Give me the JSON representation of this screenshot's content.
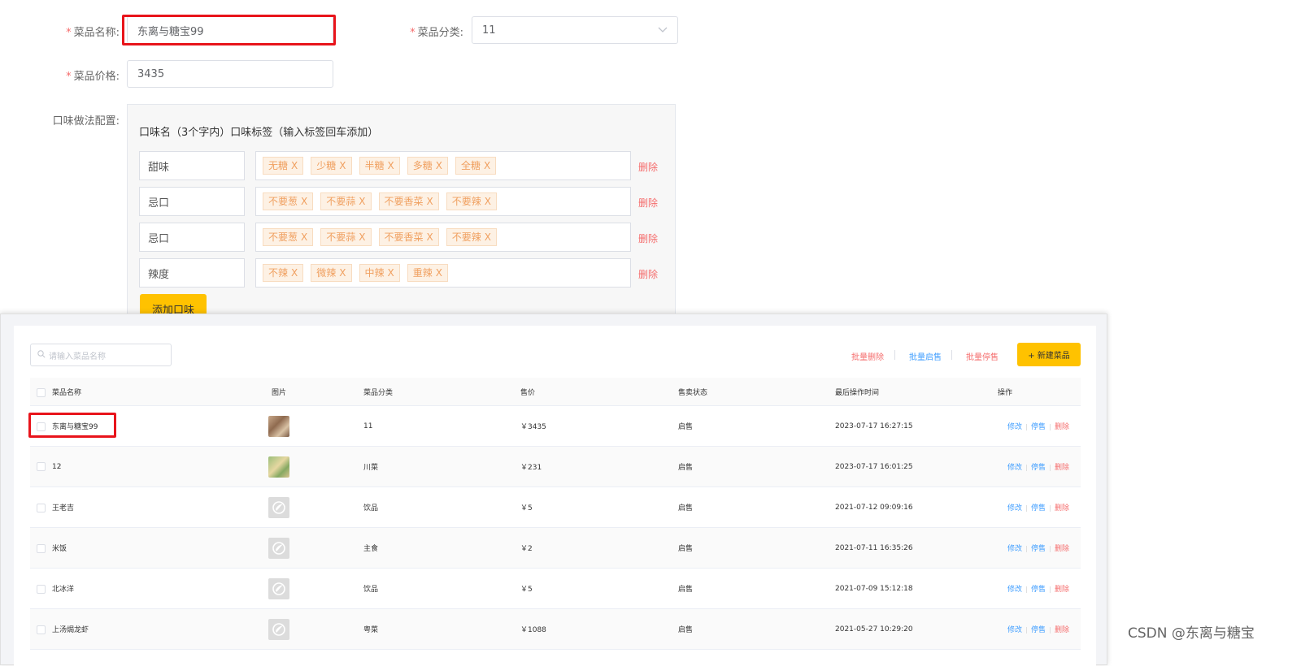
{
  "form": {
    "name_label": "菜品名称:",
    "name_value": "东离与糖宝99",
    "category_label": "菜品分类:",
    "category_value": "11",
    "price_label": "菜品价格:",
    "price_value": "3435",
    "flavor_label": "口味做法配置:",
    "flavor_header": "口味名（3个字内）口味标签（输入标签回车添加）",
    "tag_close": "X",
    "delete_label": "删除",
    "add_flavor_label": "添加口味",
    "flavors": [
      {
        "name": "甜味",
        "tags": [
          "无糖",
          "少糖",
          "半糖",
          "多糖",
          "全糖"
        ]
      },
      {
        "name": "忌口",
        "tags": [
          "不要葱",
          "不要蒜",
          "不要香菜",
          "不要辣"
        ]
      },
      {
        "name": "忌口",
        "tags": [
          "不要葱",
          "不要蒜",
          "不要香菜",
          "不要辣"
        ]
      },
      {
        "name": "辣度",
        "tags": [
          "不辣",
          "微辣",
          "中辣",
          "重辣"
        ]
      }
    ]
  },
  "list": {
    "search_placeholder": "请输入菜品名称",
    "batch_delete": "批量删除",
    "batch_enable": "批量启售",
    "batch_disable": "批量停售",
    "new_dish": "+ 新建菜品",
    "columns": [
      "菜品名称",
      "图片",
      "菜品分类",
      "售价",
      "售卖状态",
      "最后操作时间",
      "操作"
    ],
    "actions": {
      "edit": "修改",
      "stop": "停售",
      "delete": "删除"
    },
    "rows": [
      {
        "name": "东离与糖宝99",
        "image": "photo1",
        "category": "11",
        "price": "￥3435",
        "status": "启售",
        "time": "2023-07-17 16:27:15"
      },
      {
        "name": "12",
        "image": "photo2",
        "category": "川菜",
        "price": "￥231",
        "status": "启售",
        "time": "2023-07-17 16:01:25"
      },
      {
        "name": "王老吉",
        "image": "placeholder",
        "category": "饮品",
        "price": "￥5",
        "status": "启售",
        "time": "2021-07-12 09:09:16"
      },
      {
        "name": "米饭",
        "image": "placeholder",
        "category": "主食",
        "price": "￥2",
        "status": "启售",
        "time": "2021-07-11 16:35:26"
      },
      {
        "name": "北冰洋",
        "image": "placeholder",
        "category": "饮品",
        "price": "￥5",
        "status": "启售",
        "time": "2021-07-09 15:12:18"
      },
      {
        "name": "上汤焗龙虾",
        "image": "placeholder",
        "category": "粤菜",
        "price": "￥1088",
        "status": "启售",
        "time": "2021-05-27 10:29:20"
      }
    ]
  },
  "watermark": "CSDN @东离与糖宝",
  "colors": {
    "accent": "#ffc200",
    "highlight": "#e8141b",
    "danger": "#f56c6c",
    "link": "#409eff",
    "tag_text": "#f0a060"
  }
}
